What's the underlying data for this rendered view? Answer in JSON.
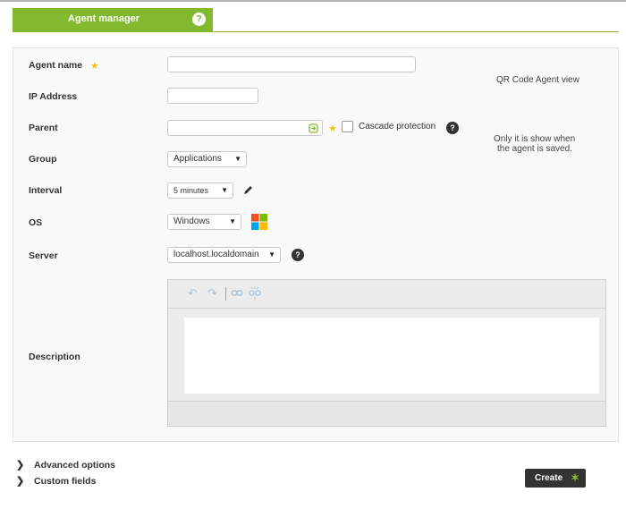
{
  "header": {
    "title": "Agent manager",
    "help_icon": "?"
  },
  "form": {
    "agent_name": {
      "label": "Agent name",
      "value": "",
      "placeholder": ""
    },
    "ip_address": {
      "label": "IP Address",
      "value": ""
    },
    "parent": {
      "label": "Parent",
      "value": "",
      "cascade_label": "Cascade protection",
      "cascade_checked": false
    },
    "group": {
      "label": "Group",
      "selected": "Applications"
    },
    "interval": {
      "label": "Interval",
      "selected": "5 minutes"
    },
    "os": {
      "label": "OS",
      "selected": "Windows"
    },
    "server": {
      "label": "Server",
      "selected": "localhost.localdomain"
    },
    "description": {
      "label": "Description",
      "value": ""
    }
  },
  "qr": {
    "title": "QR Code Agent view",
    "note_line1": "Only it is show when",
    "note_line2": "the agent is saved."
  },
  "bottom": {
    "advanced_options": "Advanced options",
    "custom_fields": "Custom fields",
    "create_button": "Create"
  },
  "colors": {
    "accent": "#82b92e",
    "dark_button": "#333333",
    "star": "#f0c419"
  },
  "icons": {
    "help": "question-circle-icon",
    "required": "star-icon",
    "parent_picker": "agent-picker-icon",
    "interval_edit": "pencil-icon",
    "os_logo": "windows-logo-icon",
    "editor_undo": "undo-icon",
    "editor_redo": "redo-icon",
    "editor_link": "link-icon",
    "editor_unlink": "unlink-icon",
    "expand": "chevron-right-icon",
    "create": "magic-wand-icon"
  }
}
